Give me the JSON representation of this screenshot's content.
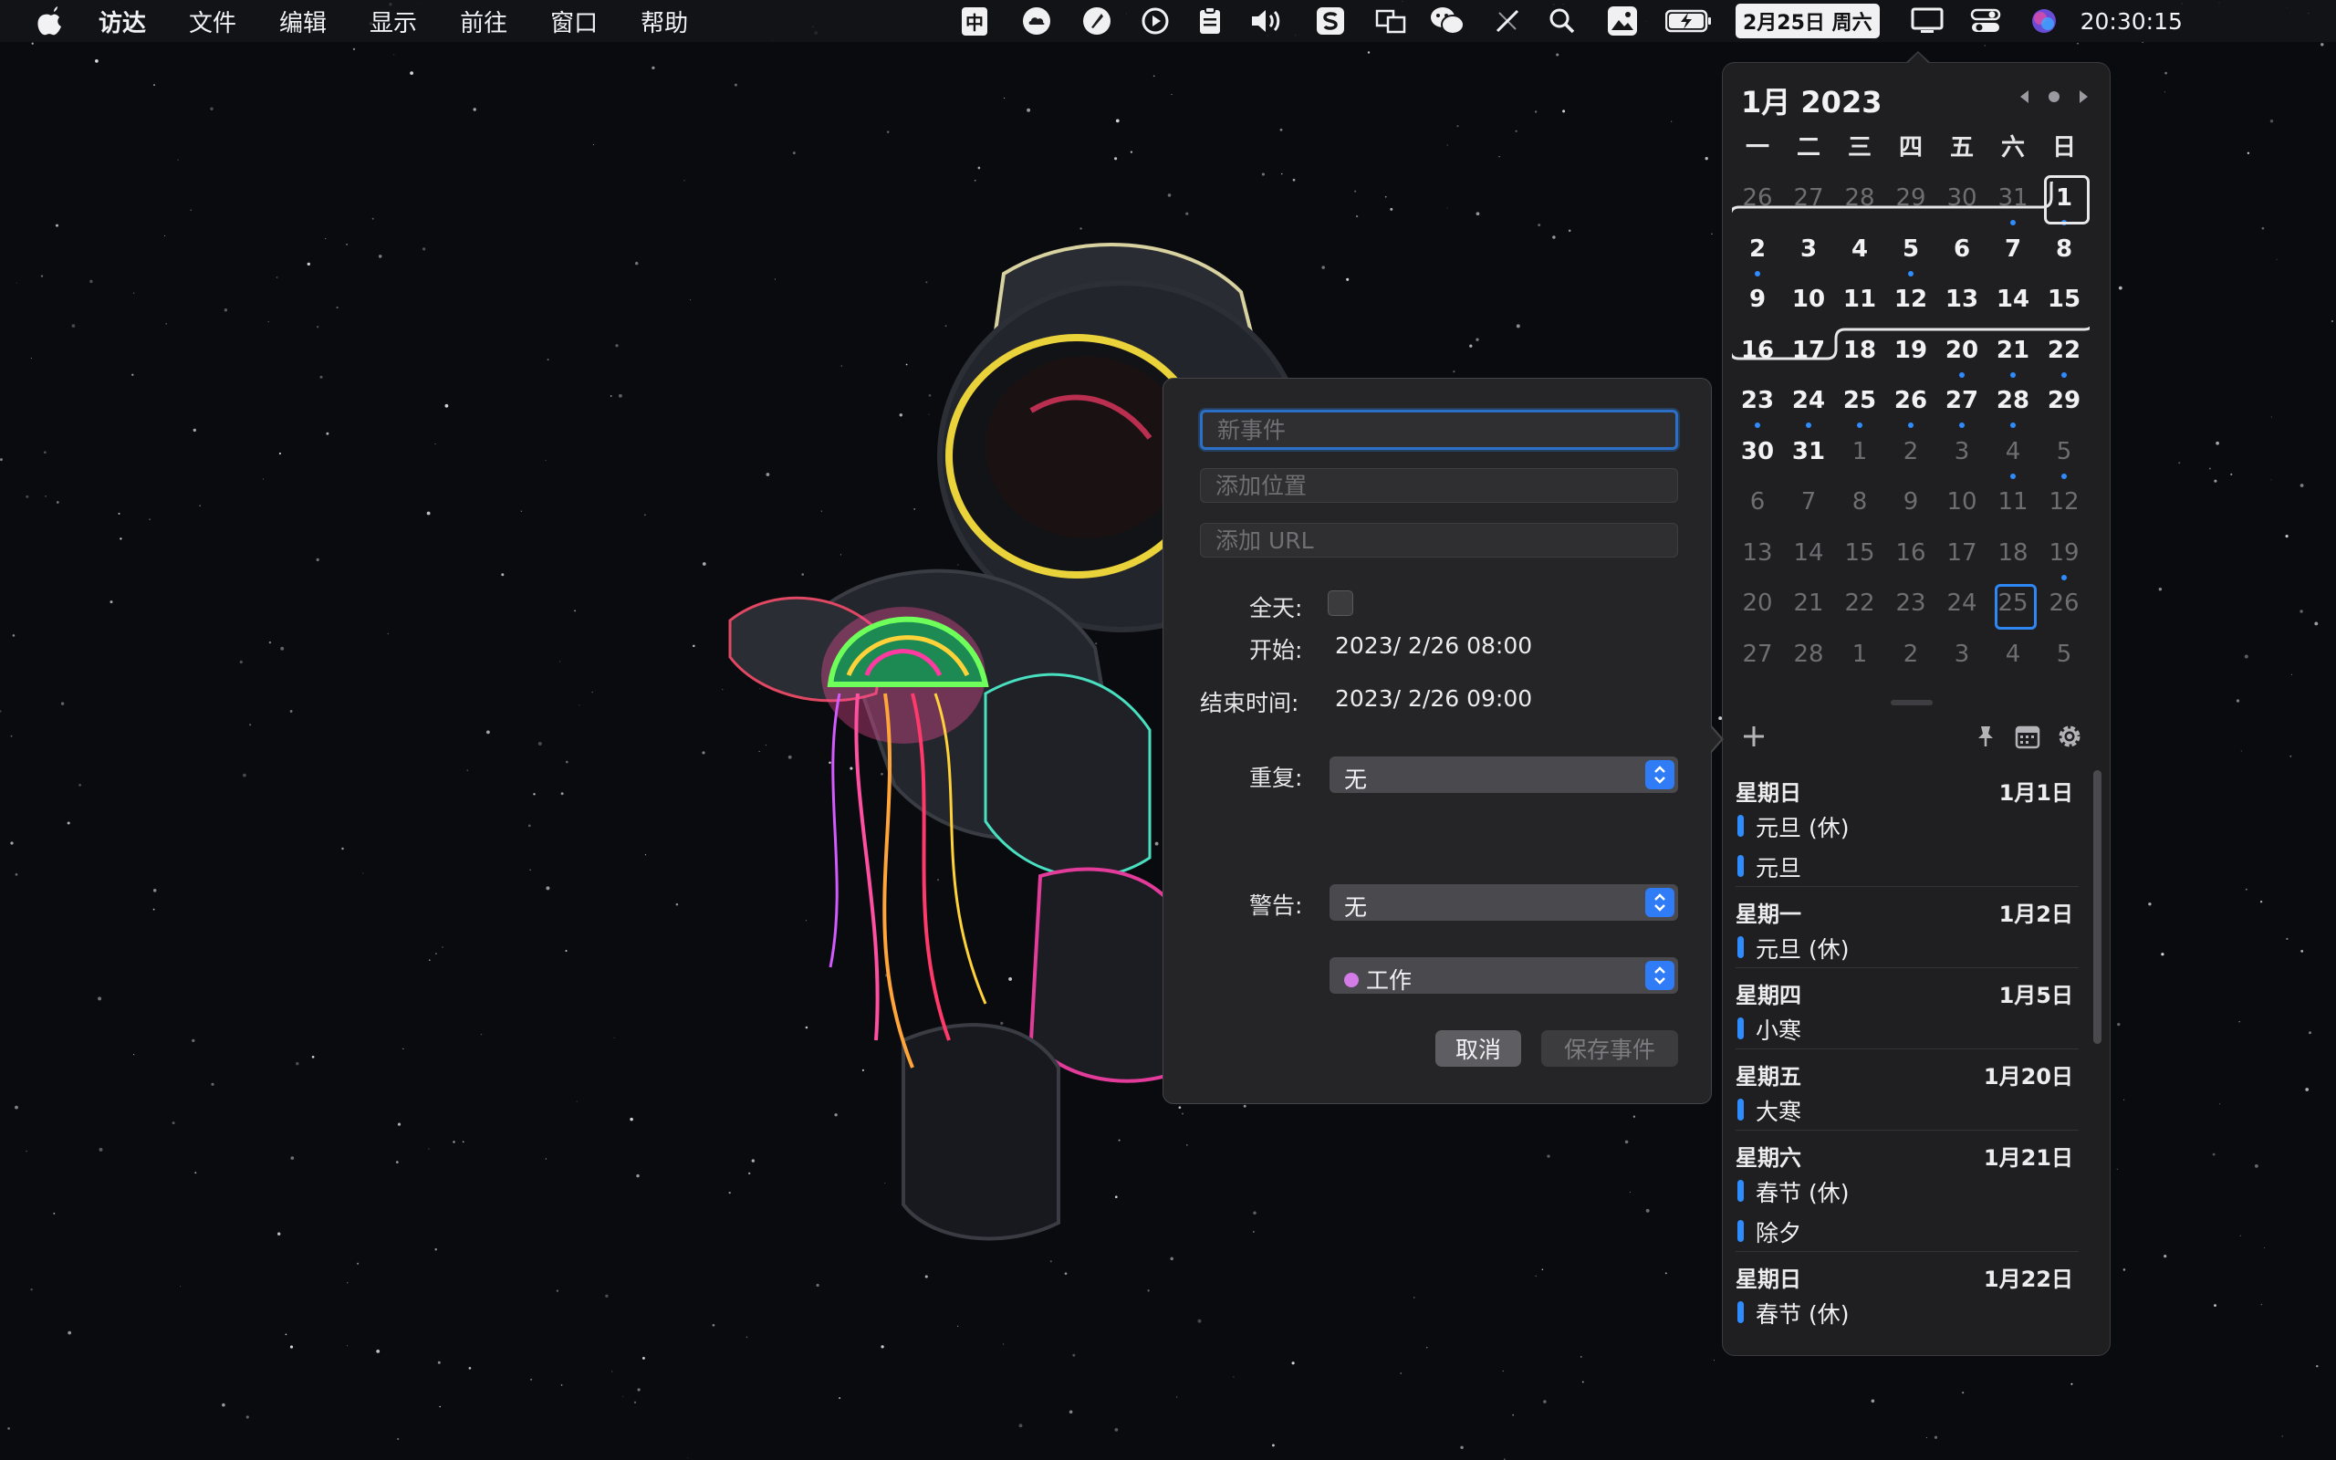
{
  "menubar": {
    "app_name": "访达",
    "menus": [
      "文件",
      "编辑",
      "显示",
      "前往",
      "窗口",
      "帮助"
    ],
    "input_method": "中",
    "date_badge": "2月25日 周六",
    "clock": "20:30:15"
  },
  "calendar": {
    "month_title": "1月 2023",
    "weekdays": [
      "一",
      "二",
      "三",
      "四",
      "五",
      "六",
      "日"
    ],
    "weeks": [
      [
        {
          "d": "26",
          "o": true
        },
        {
          "d": "27",
          "o": true
        },
        {
          "d": "28",
          "o": true
        },
        {
          "d": "29",
          "o": true
        },
        {
          "d": "30",
          "o": true
        },
        {
          "d": "31",
          "o": true,
          "ev": true
        },
        {
          "d": "1",
          "ev": true,
          "sel": true
        }
      ],
      [
        {
          "d": "2",
          "ev": true
        },
        {
          "d": "3"
        },
        {
          "d": "4"
        },
        {
          "d": "5",
          "ev": true
        },
        {
          "d": "6"
        },
        {
          "d": "7"
        },
        {
          "d": "8"
        }
      ],
      [
        {
          "d": "9"
        },
        {
          "d": "10"
        },
        {
          "d": "11"
        },
        {
          "d": "12"
        },
        {
          "d": "13"
        },
        {
          "d": "14"
        },
        {
          "d": "15"
        }
      ],
      [
        {
          "d": "16"
        },
        {
          "d": "17"
        },
        {
          "d": "18"
        },
        {
          "d": "19"
        },
        {
          "d": "20",
          "ev": true
        },
        {
          "d": "21",
          "ev": true
        },
        {
          "d": "22",
          "ev": true
        }
      ],
      [
        {
          "d": "23",
          "ev": true
        },
        {
          "d": "24",
          "ev": true
        },
        {
          "d": "25",
          "ev": true
        },
        {
          "d": "26",
          "ev": true
        },
        {
          "d": "27",
          "ev": true
        },
        {
          "d": "28",
          "ev": true
        },
        {
          "d": "29"
        }
      ],
      [
        {
          "d": "30"
        },
        {
          "d": "31"
        },
        {
          "d": "1",
          "o": true
        },
        {
          "d": "2",
          "o": true
        },
        {
          "d": "3",
          "o": true
        },
        {
          "d": "4",
          "o": true,
          "ev": true
        },
        {
          "d": "5",
          "o": true,
          "ev": true
        }
      ],
      [
        {
          "d": "6",
          "o": true
        },
        {
          "d": "7",
          "o": true
        },
        {
          "d": "8",
          "o": true
        },
        {
          "d": "9",
          "o": true
        },
        {
          "d": "10",
          "o": true
        },
        {
          "d": "11",
          "o": true
        },
        {
          "d": "12",
          "o": true
        }
      ],
      [
        {
          "d": "13",
          "o": true
        },
        {
          "d": "14",
          "o": true
        },
        {
          "d": "15",
          "o": true
        },
        {
          "d": "16",
          "o": true
        },
        {
          "d": "17",
          "o": true
        },
        {
          "d": "18",
          "o": true
        },
        {
          "d": "19",
          "o": true,
          "ev": true
        }
      ],
      [
        {
          "d": "20",
          "o": true
        },
        {
          "d": "21",
          "o": true
        },
        {
          "d": "22",
          "o": true
        },
        {
          "d": "23",
          "o": true
        },
        {
          "d": "24",
          "o": true
        },
        {
          "d": "25",
          "o": true,
          "today": true
        },
        {
          "d": "26",
          "o": true
        }
      ],
      [
        {
          "d": "27",
          "o": true
        },
        {
          "d": "28",
          "o": true
        },
        {
          "d": "1",
          "o": true
        },
        {
          "d": "2",
          "o": true
        },
        {
          "d": "3",
          "o": true
        },
        {
          "d": "4",
          "o": true
        },
        {
          "d": "5",
          "o": true
        }
      ]
    ],
    "agenda": [
      {
        "dow": "星期日",
        "date": "1月1日",
        "events": [
          "元旦 (休)",
          "元旦"
        ]
      },
      {
        "dow": "星期一",
        "date": "1月2日",
        "events": [
          "元旦 (休)"
        ]
      },
      {
        "dow": "星期四",
        "date": "1月5日",
        "events": [
          "小寒"
        ]
      },
      {
        "dow": "星期五",
        "date": "1月20日",
        "events": [
          "大寒"
        ]
      },
      {
        "dow": "星期六",
        "date": "1月21日",
        "events": [
          "春节 (休)",
          "除夕"
        ]
      },
      {
        "dow": "星期日",
        "date": "1月22日",
        "events": [
          "春节 (休)"
        ]
      }
    ],
    "event_color": "#2f8cff"
  },
  "event_form": {
    "title_placeholder": "新事件",
    "location_placeholder": "添加位置",
    "url_placeholder": "添加 URL",
    "allday_label": "全天:",
    "start_label": "开始:",
    "start_value": "2023/  2/26 08:00",
    "end_label": "结束时间:",
    "end_value": "2023/  2/26 09:00",
    "repeat_label": "重复:",
    "repeat_value": "无",
    "alert_label": "警告:",
    "alert_value": "无",
    "calendar_value": "工作",
    "calendar_color": "#d37be6",
    "cancel_label": "取消",
    "save_label": "保存事件"
  }
}
